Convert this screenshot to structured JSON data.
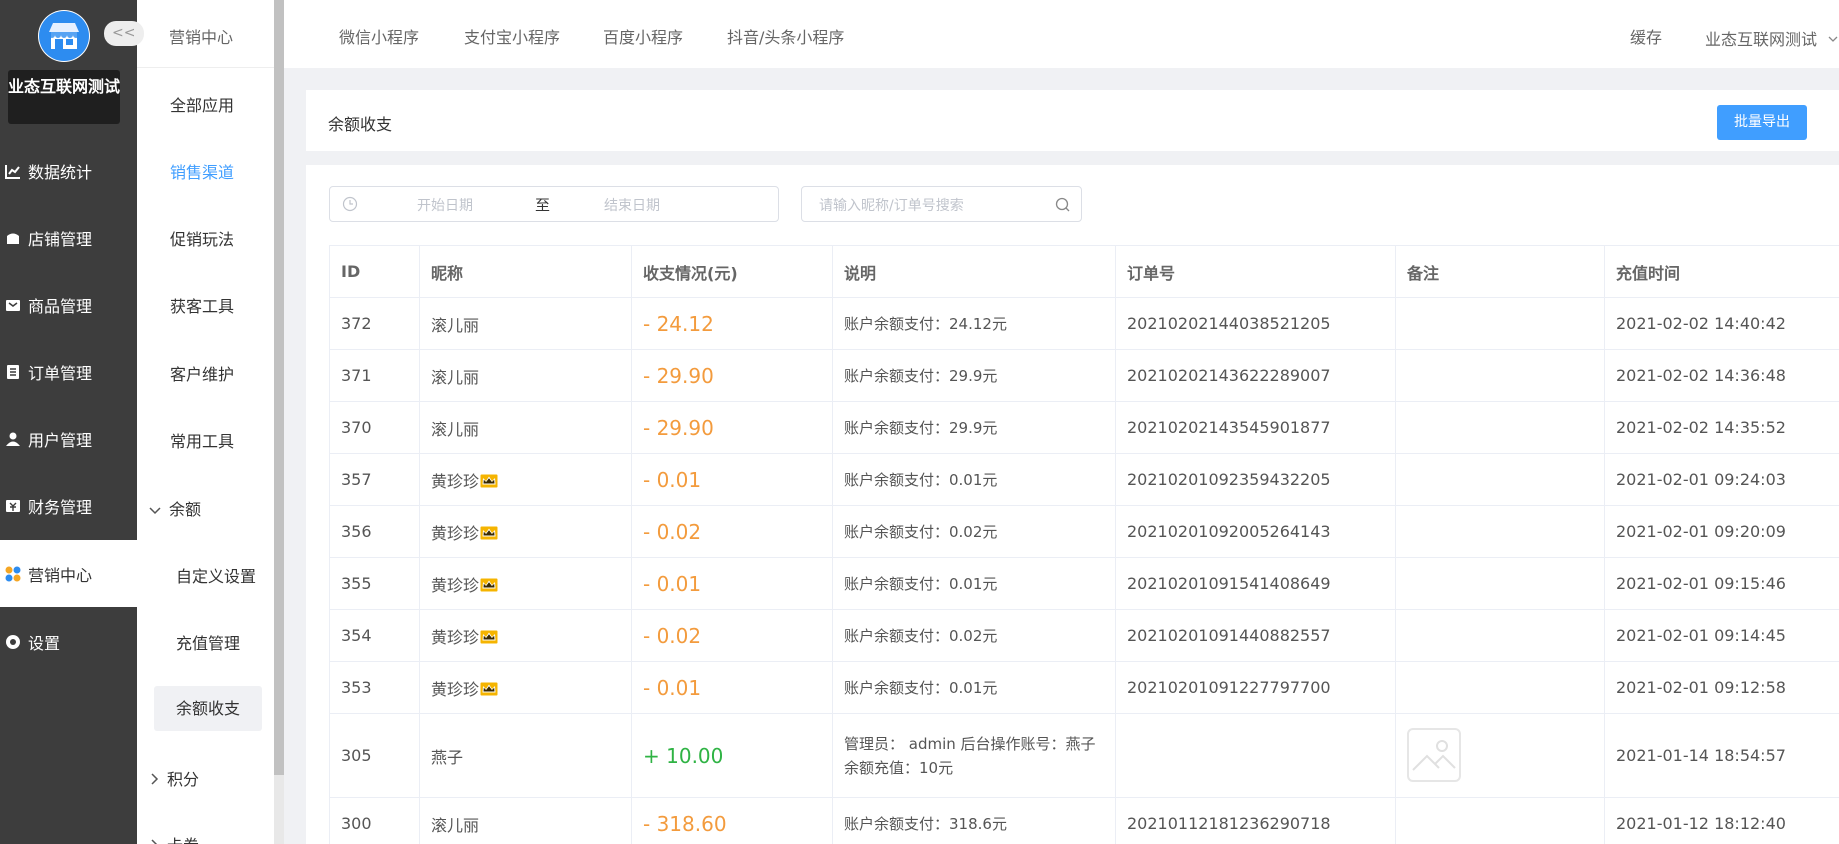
{
  "sidebar": {
    "shop_name": "业态互联网测试",
    "items": [
      {
        "label": "数据统计",
        "icon": "chart-icon"
      },
      {
        "label": "店铺管理",
        "icon": "shop-icon"
      },
      {
        "label": "商品管理",
        "icon": "goods-icon"
      },
      {
        "label": "订单管理",
        "icon": "order-icon"
      },
      {
        "label": "用户管理",
        "icon": "user-icon"
      },
      {
        "label": "财务管理",
        "icon": "finance-icon"
      },
      {
        "label": "营销中心",
        "icon": "marketing-icon",
        "active": true
      },
      {
        "label": "设置",
        "icon": "settings-icon"
      }
    ]
  },
  "subnav": {
    "title": "营销中心",
    "collapse": "<<",
    "items": [
      "全部应用",
      "销售渠道",
      "促销玩法",
      "获客工具",
      "客户维护",
      "常用工具"
    ],
    "balance_group": "余额",
    "balance_children": [
      "自定义设置",
      "充值管理",
      "余额收支"
    ],
    "points": "积分",
    "coupon": "卡券"
  },
  "topbar": {
    "tabs": [
      "微信小程序",
      "支付宝小程序",
      "百度小程序",
      "抖音/头条小程序"
    ],
    "cache": "缓存",
    "account": "业态互联网测试"
  },
  "page": {
    "title": "余额收支",
    "export_label": "批量导出",
    "date_start_placeholder": "开始日期",
    "date_to": "至",
    "date_end_placeholder": "结束日期",
    "search_placeholder": "请输入昵称/订单号搜索"
  },
  "table": {
    "headers": [
      "ID",
      "昵称",
      "收支情况(元)",
      "说明",
      "订单号",
      "备注",
      "充值时间"
    ],
    "rows": [
      {
        "id": "372",
        "name": "滚儿丽",
        "crown": false,
        "amount": "- 24.12",
        "type": "neg",
        "desc": "账户余额支付：24.12元",
        "order": "20210202144038521205",
        "time": "2021-02-02 14:40:42"
      },
      {
        "id": "371",
        "name": "滚儿丽",
        "crown": false,
        "amount": "- 29.90",
        "type": "neg",
        "desc": "账户余额支付：29.9元",
        "order": "20210202143622289007",
        "time": "2021-02-02 14:36:48"
      },
      {
        "id": "370",
        "name": "滚儿丽",
        "crown": false,
        "amount": "- 29.90",
        "type": "neg",
        "desc": "账户余额支付：29.9元",
        "order": "20210202143545901877",
        "time": "2021-02-02 14:35:52"
      },
      {
        "id": "357",
        "name": "黄珍珍",
        "crown": true,
        "amount": "- 0.01",
        "type": "neg",
        "desc": "账户余额支付：0.01元",
        "order": "20210201092359432205",
        "time": "2021-02-01 09:24:03"
      },
      {
        "id": "356",
        "name": "黄珍珍",
        "crown": true,
        "amount": "- 0.02",
        "type": "neg",
        "desc": "账户余额支付：0.02元",
        "order": "20210201092005264143",
        "time": "2021-02-01 09:20:09"
      },
      {
        "id": "355",
        "name": "黄珍珍",
        "crown": true,
        "amount": "- 0.01",
        "type": "neg",
        "desc": "账户余额支付：0.01元",
        "order": "20210201091541408649",
        "time": "2021-02-01 09:15:46"
      },
      {
        "id": "354",
        "name": "黄珍珍",
        "crown": true,
        "amount": "- 0.02",
        "type": "neg",
        "desc": "账户余额支付：0.02元",
        "order": "20210201091440882557",
        "time": "2021-02-01 09:14:45"
      },
      {
        "id": "353",
        "name": "黄珍珍",
        "crown": true,
        "amount": "- 0.01",
        "type": "neg",
        "desc": "账户余额支付：0.01元",
        "order": "20210201091227797700",
        "time": "2021-02-01 09:12:58"
      },
      {
        "id": "305",
        "name": "燕子",
        "crown": false,
        "amount": "+ 10.00",
        "type": "pos",
        "desc": "管理员： admin 后台操作账号：燕子 余额充值：10元",
        "order": "",
        "time": "2021-01-14 18:54:57",
        "note_image": true
      },
      {
        "id": "300",
        "name": "滚儿丽",
        "crown": false,
        "amount": "- 318.60",
        "type": "neg",
        "desc": "账户余额支付：318.6元",
        "order": "20210112181236290718",
        "time": "2021-01-12 18:12:40"
      }
    ]
  },
  "colors": {
    "accent": "#409eff",
    "negative": "#f39b3d",
    "positive": "#2fb344",
    "sidebar": "#3d3d3d"
  }
}
